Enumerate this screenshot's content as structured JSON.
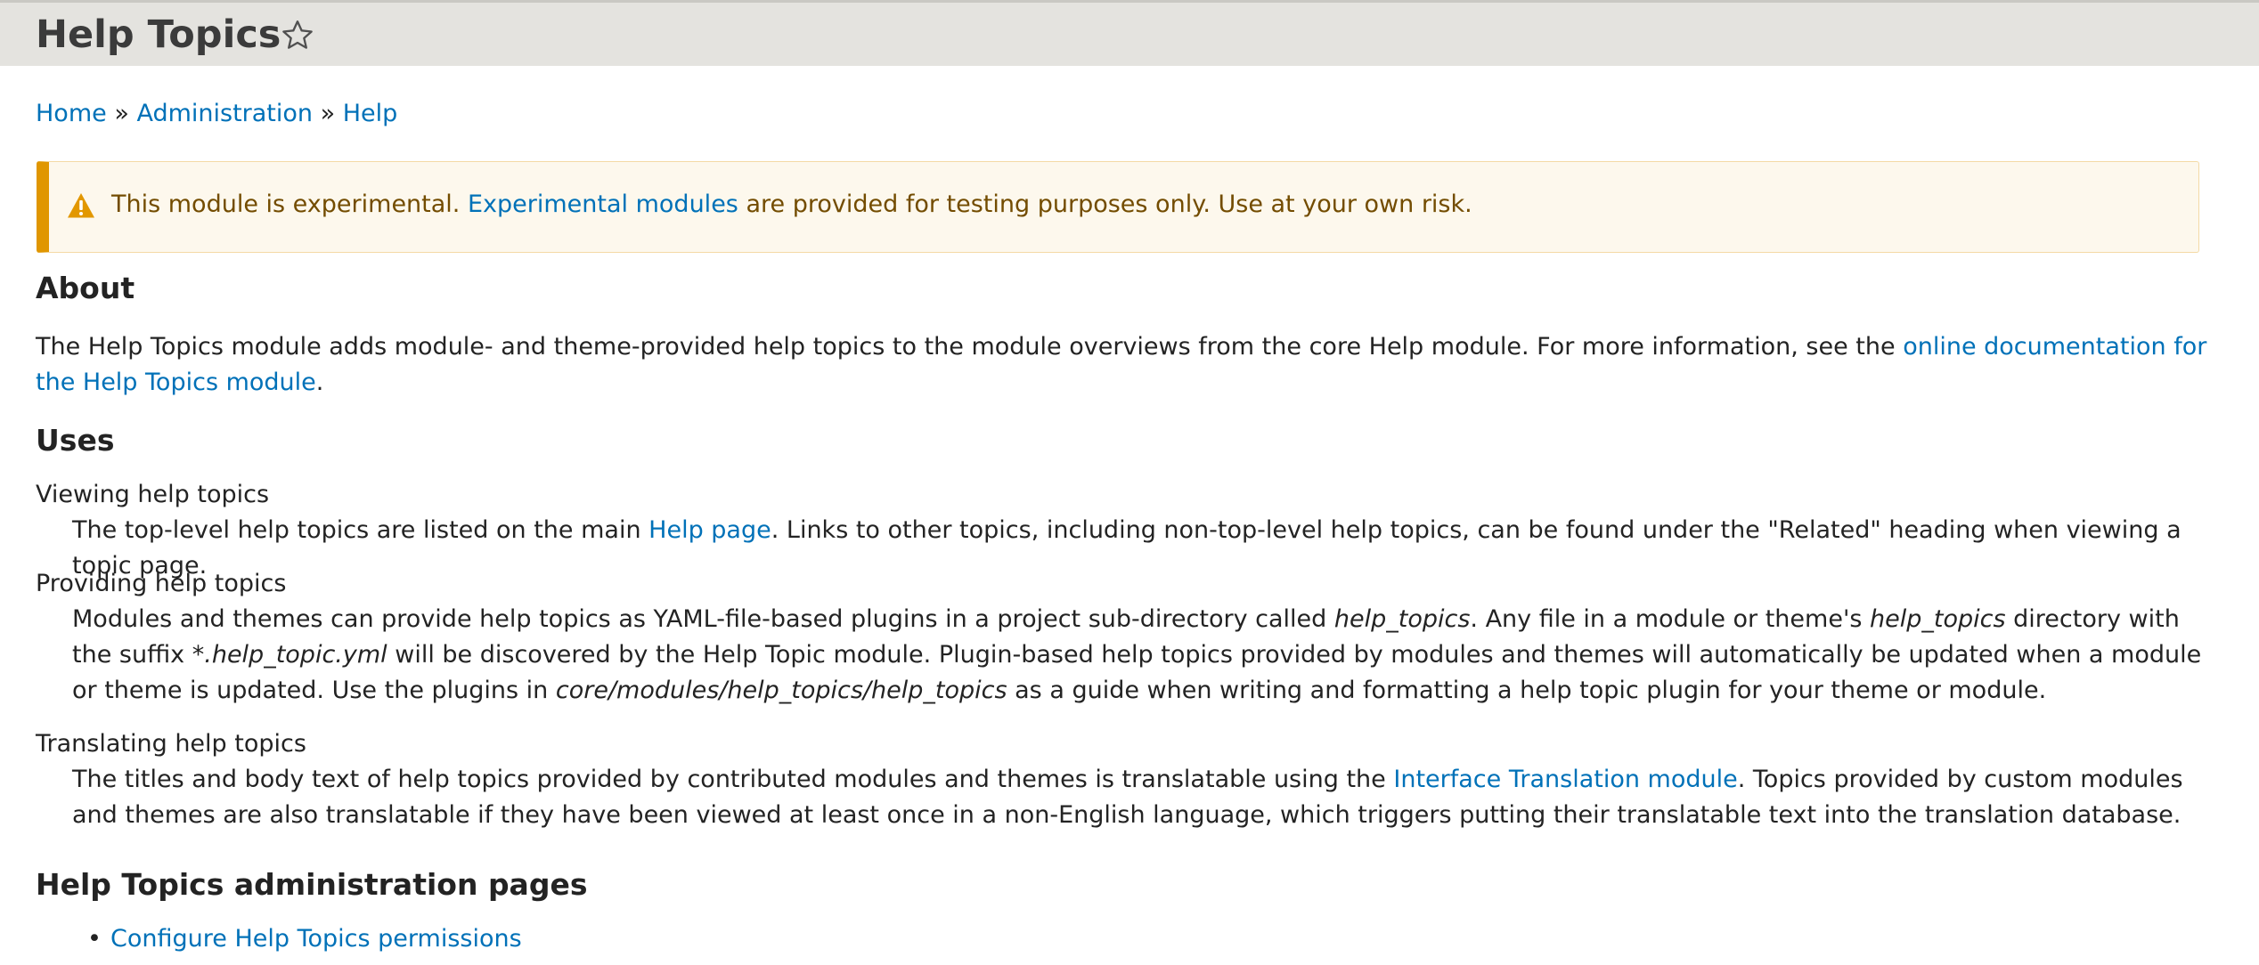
{
  "header": {
    "title": "Help Topics"
  },
  "breadcrumb": {
    "home": "Home",
    "administration": "Administration",
    "help": "Help",
    "separator": "»"
  },
  "warning": {
    "text_before": "This module is experimental.",
    "link": "Experimental modules",
    "text_after": "are provided for testing purposes only. Use at your own risk."
  },
  "about": {
    "heading": "About",
    "text": "The Help Topics module adds module- and theme-provided help topics to the module overviews from the core Help module. For more information, see the",
    "link": "online documentation for the Help Topics module",
    "end": "."
  },
  "uses": {
    "heading": "Uses",
    "viewing": {
      "term": "Viewing help topics",
      "before": "The top-level help topics are listed on the main",
      "link": "Help page",
      "after": ". Links to other topics, including non-top-level help topics, can be found under the \"Related\" heading when viewing a topic page."
    },
    "providing": {
      "term": "Providing help topics",
      "part1": "Modules and themes can provide help topics as YAML-file-based plugins in a project sub-directory called",
      "em1": "help_topics",
      "part2": ". Any file in a module or theme's",
      "em2": "help_topics",
      "part3": "directory with the suffix",
      "em3": "*.help_topic.yml",
      "part4": "will be discovered by the Help Topic module. Plugin-based help topics provided by modules and themes will automatically be updated when a module or theme is updated. Use the plugins in",
      "em4": "core/modules/help_topics/help_topics",
      "part5": "as a guide when writing and formatting a help topic plugin for your theme or module."
    },
    "translating": {
      "term": "Translating help topics",
      "before": "The titles and body text of help topics provided by contributed modules and themes is translatable using the",
      "link": "Interface Translation module",
      "after": ". Topics provided by custom modules and themes are also translatable if they have been viewed at least once in a non-English language, which triggers putting their translatable text into the translation database."
    }
  },
  "admin_pages": {
    "heading": "Help Topics administration pages",
    "items": [
      "Configure Help Topics permissions"
    ]
  },
  "colors": {
    "link": "#0071b8",
    "warning_border": "#e09600",
    "warning_bg": "#fdf8ed",
    "header_bg": "#e4e3df"
  },
  "icons": {
    "favorite": "star-outline-icon",
    "warning": "warning-triangle-icon"
  }
}
